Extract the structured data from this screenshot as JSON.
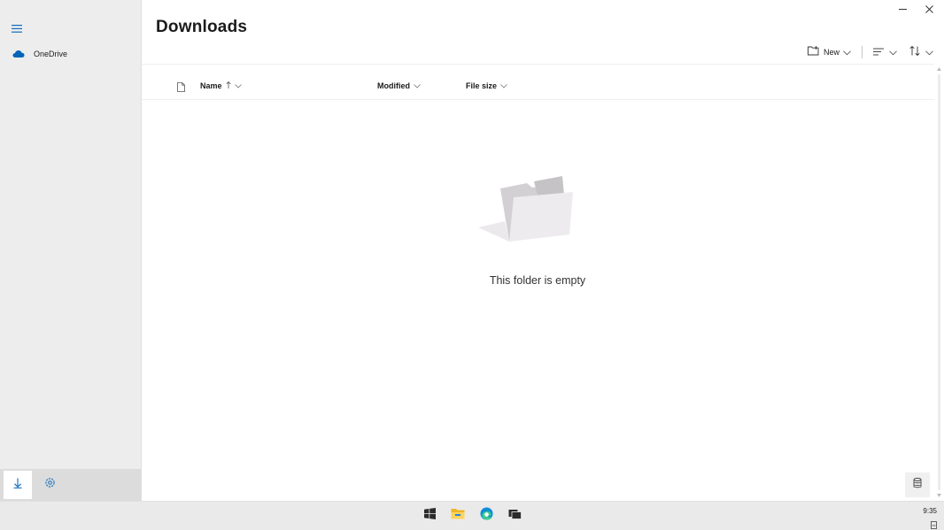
{
  "sidebar": {
    "items": [
      {
        "label": "OneDrive",
        "icon": "cloud-icon"
      }
    ],
    "bottom": [
      "download-icon",
      "settings-icon"
    ]
  },
  "main": {
    "title": "Downloads",
    "toolbar": {
      "new_label": "New"
    },
    "columns": [
      {
        "label": "Name",
        "sort": "ascending"
      },
      {
        "label": "Modified"
      },
      {
        "label": "File size"
      }
    ],
    "empty_message": "This folder is empty"
  },
  "taskbar": {
    "apps": [
      "windows-icon",
      "file-explorer-icon",
      "edge-icon",
      "task-view-icon"
    ],
    "time": "9:35"
  },
  "colors": {
    "accent": "#0f6cbd",
    "onedrive": "#0364b8",
    "sidebar_bg": "#ededed"
  }
}
